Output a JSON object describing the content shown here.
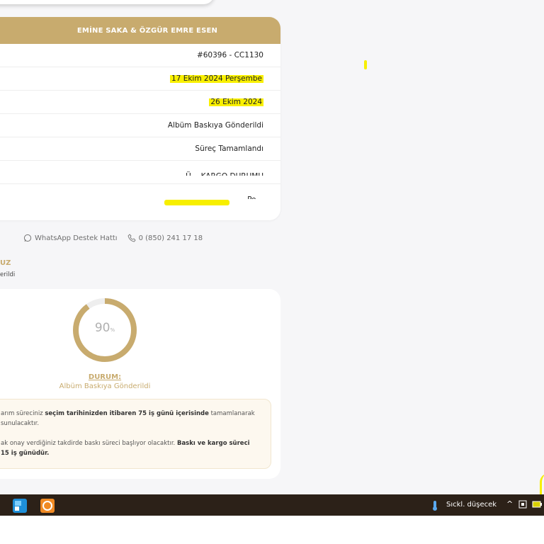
{
  "order_card": {
    "header": "EMİNE SAKA & ÖZGÜR EMRE ESEN",
    "rows": [
      {
        "value": "#60396 - CC1130"
      },
      {
        "value": "17 Ekim 2024 Perşembe"
      },
      {
        "value": "26 Ekim 2024"
      },
      {
        "value": "Albüm Baskıya Gönderildi"
      },
      {
        "value": "Süreç Tamamlandı"
      },
      {
        "value": "Ü… KARGO DURUMU"
      },
      {
        "value": "Po…"
      }
    ]
  },
  "support": {
    "whatsapp_label": "WhatsApp Destek Hattı",
    "phone": "0 (850) 241 17 18"
  },
  "section": {
    "title_fragment": "UZ",
    "sub_fragment": "erildi"
  },
  "progress": {
    "percent": 90,
    "percent_text": "90",
    "percent_sign": "%",
    "status_label": "DURUM:",
    "status_value": "Albüm Baskıya Gönderildi"
  },
  "note": {
    "p1_start": "arım süreciniz ",
    "p1_bold": "seçim tarihinizden itibaren 75 iş günü içerisinde",
    "p1_end": " tamamlanarak",
    "p1_line2": " sunulacaktır.",
    "p2_start": "ak onay verdiğiniz takdirde baskı süreci başlıyor olacaktır. ",
    "p2_bold": "Baskı ve kargo süreci",
    "p2_line2_bold": "15 iş günüdür."
  },
  "taskbar": {
    "weather_text": "Sıckl. düşecek",
    "icons": [
      "app-icon-1",
      "app-icon-2",
      "thermometer-icon",
      "chevron-up-icon",
      "tray-icon",
      "battery-icon"
    ]
  },
  "colors": {
    "accent": "#c8ab6e",
    "highlight": "#f9f000",
    "taskbar": "#2c2118"
  }
}
